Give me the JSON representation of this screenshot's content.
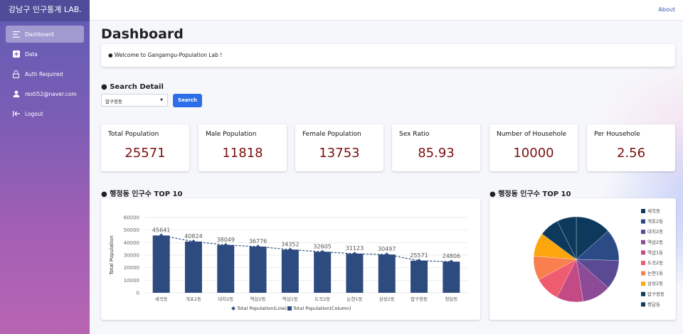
{
  "app": {
    "brand": "강남구 인구통계 LAB."
  },
  "sidebar": {
    "items": [
      {
        "label": "Dashboard",
        "icon": "menu-icon"
      },
      {
        "label": "Data",
        "icon": "plus-square-icon"
      },
      {
        "label": "Auth Required",
        "icon": "lock-icon"
      },
      {
        "label": "resti52@naver.com",
        "icon": "user-icon"
      },
      {
        "label": "Logout",
        "icon": "logout-icon"
      }
    ]
  },
  "topbar": {
    "about": "About"
  },
  "main": {
    "title": "Dashboard",
    "welcome": "● Welcome to Gangamgu-Population Lab !",
    "search_title": "● Search Detail",
    "search_select": "압구정동",
    "search_button": "Search"
  },
  "stats": [
    {
      "label": "Total Population",
      "value": "25571"
    },
    {
      "label": "Male Population",
      "value": "11818"
    },
    {
      "label": "Female Population",
      "value": "13753"
    },
    {
      "label": "Sex Ratio",
      "value": "85.93"
    },
    {
      "label": "Number of Househole",
      "value": "10000"
    },
    {
      "label": "Per Househole",
      "value": "2.56"
    }
  ],
  "bar_title": "● 행정동 인구수 TOP 10",
  "pie_title": "● 행정동 인구수 TOP 10",
  "chart_data": [
    {
      "type": "bar",
      "title": "",
      "ylabel": "Total Population",
      "xlabel": "",
      "ylim": [
        0,
        60000
      ],
      "yticks": [
        "0",
        "10000",
        "20000",
        "30000",
        "40000",
        "50000",
        "60000"
      ],
      "categories": [
        "세곡동",
        "개포2동",
        "대치2동",
        "역삼2동",
        "역삼1동",
        "도곡2동",
        "논현1동",
        "삼성2동",
        "압구정동",
        "청담동"
      ],
      "series": [
        {
          "name": "Total Population(Line)",
          "values": [
            45641,
            40824,
            38049,
            36776,
            34352,
            32605,
            31123,
            30497,
            25571,
            24806
          ]
        },
        {
          "name": "Total Population(Column)",
          "values": [
            45641,
            40824,
            38049,
            36776,
            34352,
            32605,
            31123,
            30497,
            25571,
            24806
          ]
        }
      ],
      "legend": "bottom",
      "colors": {
        "bar": "#2e4b7f",
        "line": "#2e4b7f"
      }
    },
    {
      "type": "pie",
      "categories": [
        "세곡동",
        "개포2동",
        "대치2동",
        "역삼2동",
        "역삼1동",
        "도곡2동",
        "논현1동",
        "삼성2동",
        "압구정동",
        "청담동"
      ],
      "values": [
        45641,
        40824,
        38049,
        36776,
        34352,
        32605,
        31123,
        30497,
        25571,
        24806
      ],
      "colors": [
        "#0d3a5c",
        "#2c4b86",
        "#5a4a93",
        "#8d4a96",
        "#c44a86",
        "#ef5b6f",
        "#f9804e",
        "#fba60d",
        "#0d3a5c",
        "#0d3a5c"
      ],
      "legend": "right"
    }
  ]
}
